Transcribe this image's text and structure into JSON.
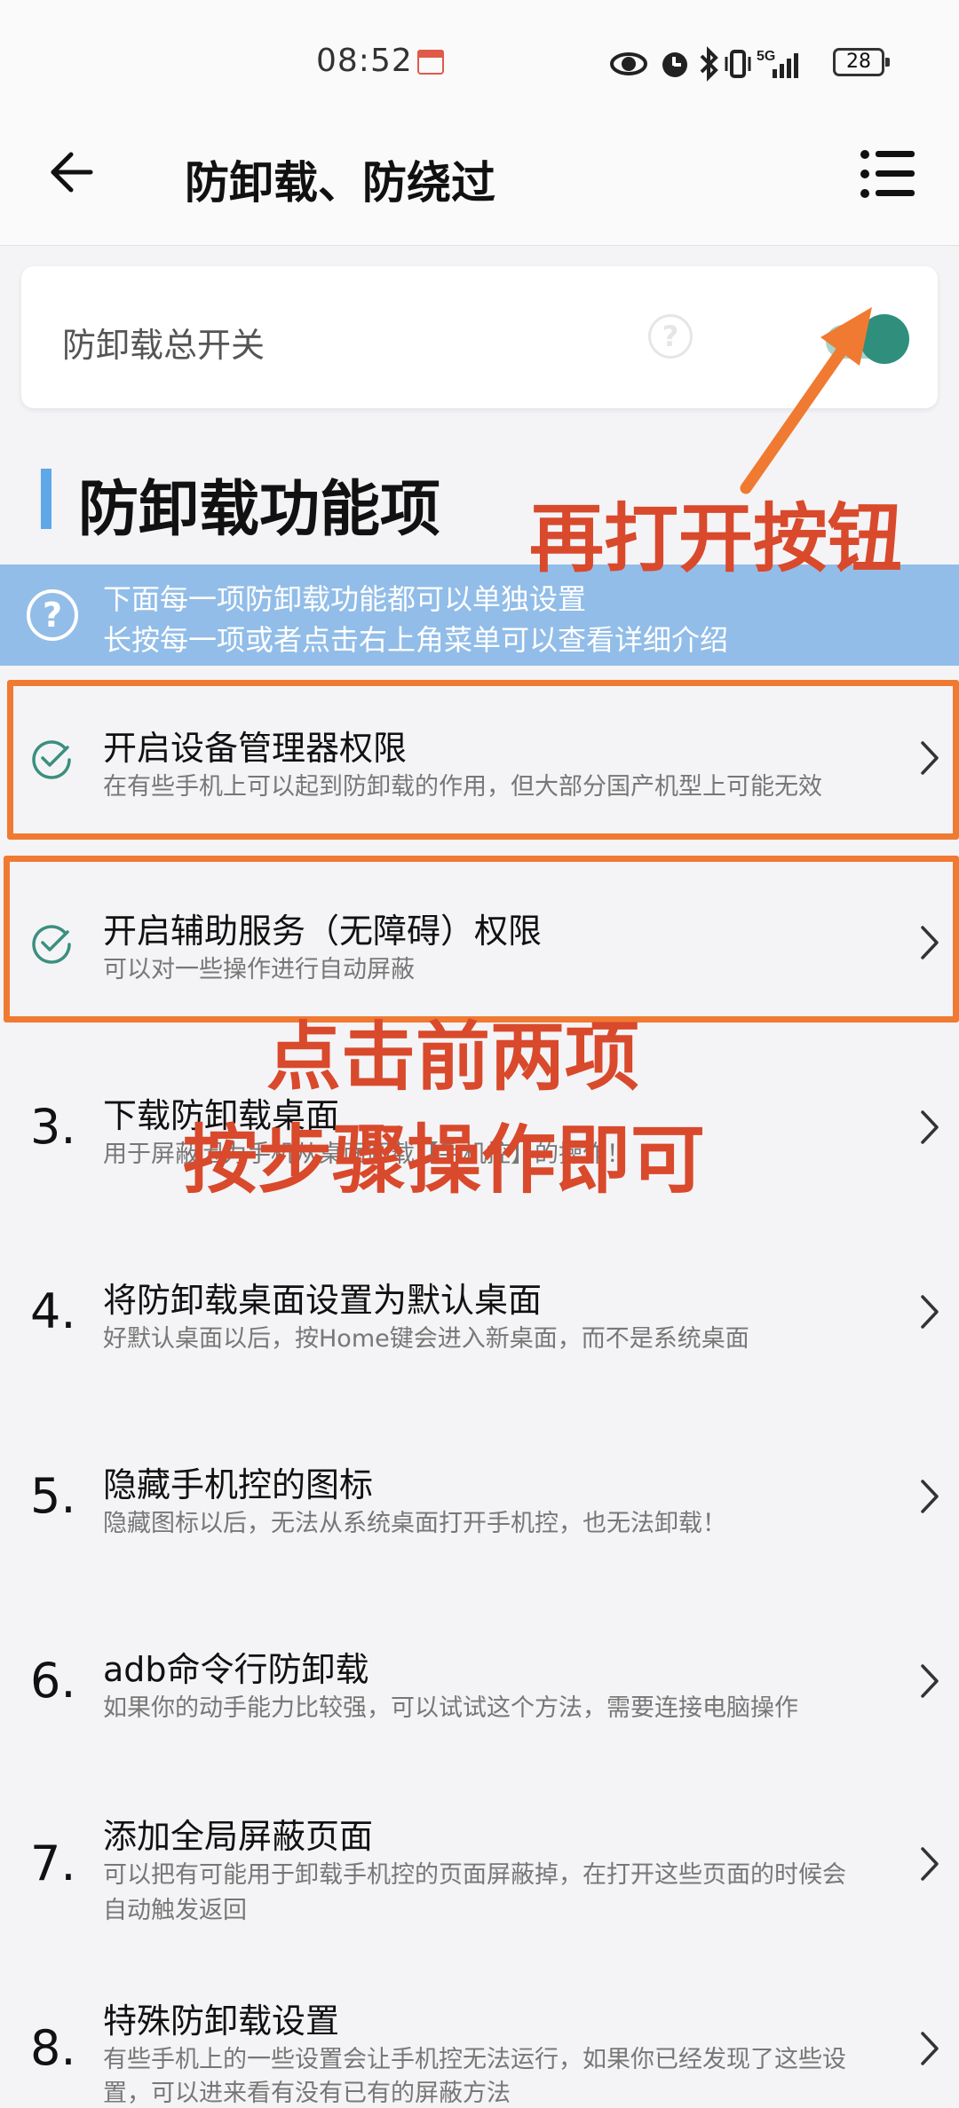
{
  "status_bar": {
    "time": "08:52",
    "battery": "28",
    "signal_label": "5G",
    "icons": [
      "calendar-icon",
      "eye-icon",
      "alarm-icon",
      "bluetooth-icon",
      "vibrate-icon",
      "signal-icon",
      "battery-icon"
    ]
  },
  "header": {
    "title": "防卸载、防绕过",
    "back_icon": "back-arrow-icon",
    "menu_icon": "list-menu-icon"
  },
  "master_switch": {
    "label": "防卸载总开关",
    "help": "?",
    "on": true,
    "accent_color": "#2f8f7c"
  },
  "section": {
    "title": "防卸载功能项"
  },
  "banner": {
    "line1": "下面每一项防卸载功能都可以单独设置",
    "line2": "长按每一项或者点击右上角菜单可以查看详细介绍",
    "help": "?"
  },
  "items": [
    {
      "marker": "check",
      "title": "开启设备管理器权限",
      "subtitle": "在有些手机上可以起到防卸载的作用，但大部分国产机型上可能无效"
    },
    {
      "marker": "check",
      "title": "开启辅助服务（无障碍）权限",
      "subtitle": "可以对一些操作进行自动屏蔽"
    },
    {
      "marker": "3.",
      "title": "下载防卸载桌面",
      "subtitle": "用于屏蔽因为手机从桌面卸载【手机控】的操作！"
    },
    {
      "marker": "4.",
      "title": "将防卸载桌面设置为默认桌面",
      "subtitle": "好默认桌面以后，按Home键会进入新桌面，而不是系统桌面"
    },
    {
      "marker": "5.",
      "title": "隐藏手机控的图标",
      "subtitle": "隐藏图标以后，无法从系统桌面打开手机控，也无法卸载！"
    },
    {
      "marker": "6.",
      "title": "adb命令行防卸载",
      "subtitle": "如果你的动手能力比较强，可以试试这个方法，需要连接电脑操作"
    },
    {
      "marker": "7.",
      "title": "添加全局屏蔽页面",
      "subtitle": "可以把有可能用于卸载手机控的页面屏蔽掉，在打开这些页面的时候会",
      "subtitle2": "自动触发返回"
    },
    {
      "marker": "8.",
      "title": "特殊防卸载设置",
      "subtitle": "有些手机上的一些设置会让手机控无法运行，如果你已经发现了这些设",
      "subtitle2": "置，可以进来看有没有已有的屏蔽方法"
    }
  ],
  "annotations": {
    "top": "再打开按钮",
    "mid1": "点击前两项",
    "mid2": "按步骤操作即可",
    "color": "#f07a31"
  }
}
